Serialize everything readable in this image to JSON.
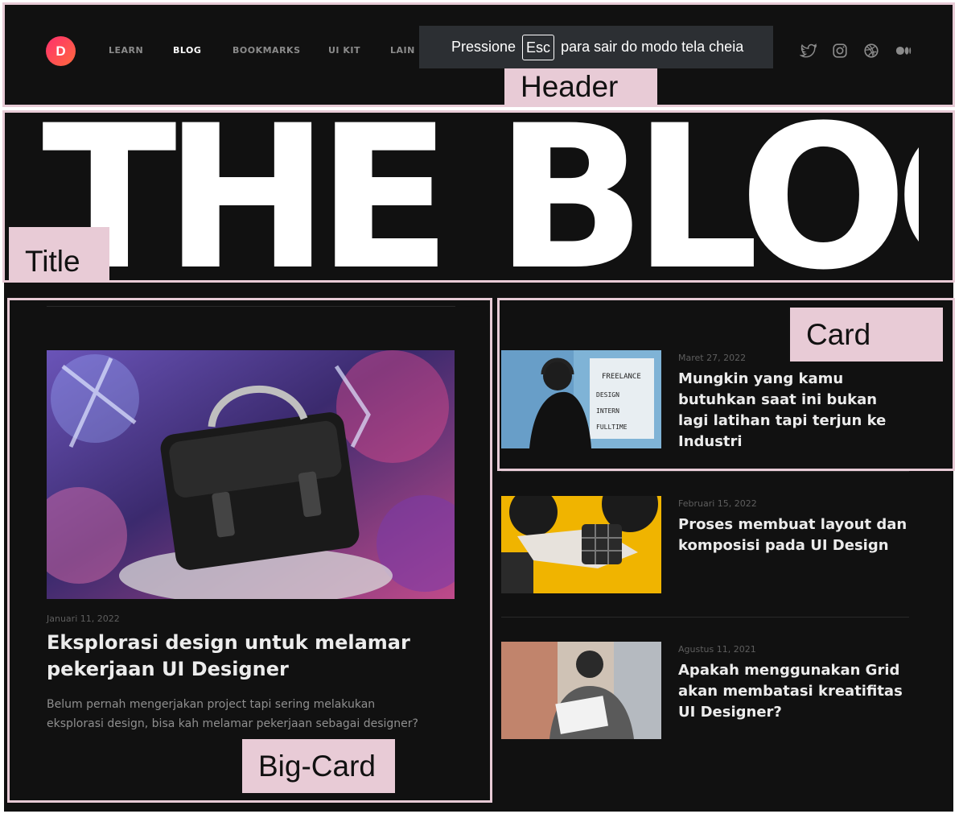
{
  "header": {
    "logo_letter": "D",
    "nav": [
      {
        "label": "LEARN",
        "active": false
      },
      {
        "label": "BLOG",
        "active": true
      },
      {
        "label": "BOOKMARKS",
        "active": false
      },
      {
        "label": "UI KIT",
        "active": false
      },
      {
        "label": "LAIN NYA",
        "active": false
      }
    ],
    "social_icons": [
      "twitter-icon",
      "instagram-icon",
      "dribbble-icon",
      "medium-icon"
    ],
    "fullscreen_notice": {
      "before": "Pressione",
      "key": "Esc",
      "after": "para sair do modo tela cheia"
    }
  },
  "title": {
    "text": "THE BLOG"
  },
  "big_card": {
    "date": "Januari 11, 2022",
    "title": "Eksplorasi design untuk melamar pekerjaan UI Designer",
    "excerpt": "Belum pernah mengerjakan project tapi sering melakukan eksplorasi design, bisa kah melamar pekerjaan sebagai designer?"
  },
  "cards": [
    {
      "date": "Maret 27, 2022",
      "title": "Mungkin yang kamu butuhkan saat ini bukan lagi latihan tapi terjun ke Industri"
    },
    {
      "date": "Februari 15, 2022",
      "title": "Proses membuat layout dan komposisi pada UI Design"
    },
    {
      "date": "Agustus 11, 2021",
      "title": "Apakah menggunakan Grid akan membatasi kreatifitas UI Designer?"
    }
  ],
  "annotations": {
    "header": "Header",
    "title": "Title",
    "card": "Card",
    "big_card": "Big-Card"
  },
  "colors": {
    "background": "#111111",
    "annotation": "#e8cbd6",
    "logo_gradient_start": "#ff2f6d",
    "logo_gradient_end": "#ff6a3d"
  }
}
